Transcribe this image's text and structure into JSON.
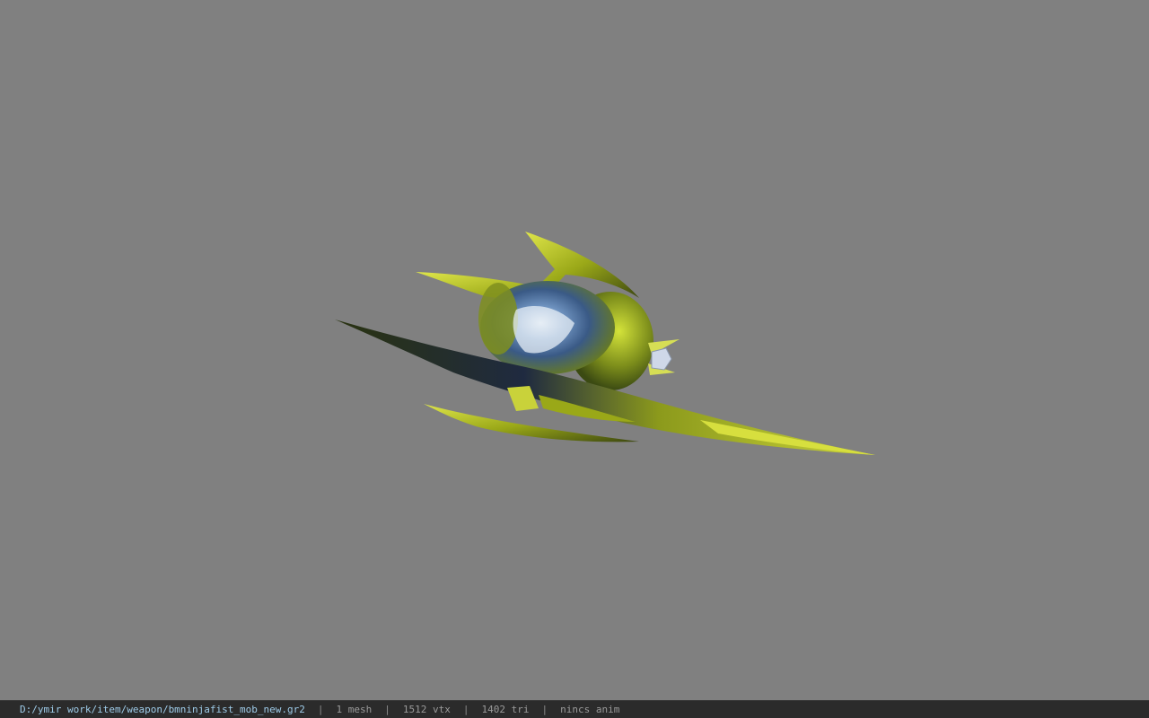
{
  "viewer": {
    "background_color": "#808080",
    "model_colors": {
      "blade_yellow": "#b9c41f",
      "blade_dark": "#2f3a10",
      "body_green": "#7f8f1e",
      "body_blue": "#3d6aa0",
      "highlight": "#e8f0ff"
    }
  },
  "statusbar": {
    "file_path": "D:/ymir work/item/weapon/bmninjafist_mob_new.gr2",
    "separator": "|",
    "mesh": "1 mesh",
    "vertices": "1512 vtx",
    "triangles": "1402 tri",
    "animation": "nincs anim"
  }
}
